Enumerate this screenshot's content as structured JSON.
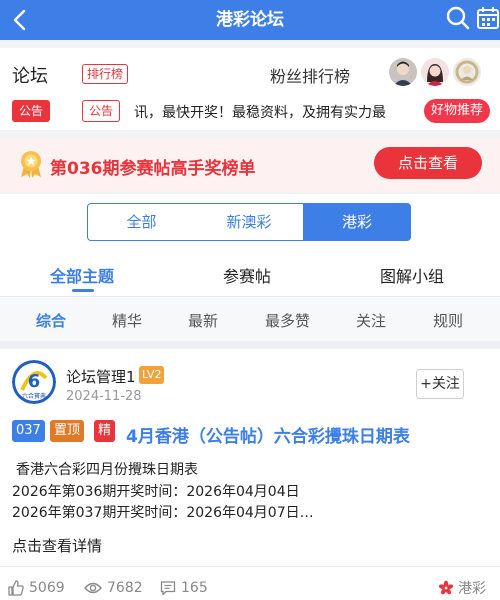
{
  "header": {
    "title": "港彩论坛"
  },
  "forum": {
    "title": "论坛",
    "rank_tag": "排行榜",
    "fans_label": "粉丝排行榜",
    "notice_tag_solid": "公告",
    "notice_tag_outline": "公告",
    "notice_text": "讯，最快开奖！最稳资料，及拥有实力最",
    "hot_button": "好物推荐"
  },
  "award": {
    "text": "第036期参赛帖高手奖榜单",
    "button": "点击查看"
  },
  "segments": [
    "全部",
    "新澳彩",
    "港彩"
  ],
  "tabs": [
    "全部主题",
    "参赛帖",
    "图解小组"
  ],
  "filters": [
    "综合",
    "精华",
    "最新",
    "最多赞",
    "关注",
    "规则"
  ],
  "post": {
    "author": "论坛管理1",
    "level": "LV2",
    "date": "2024-11-28",
    "follow": "+关注",
    "badges": [
      "037",
      "置顶",
      "精"
    ],
    "title": "4月香港（公告帖）六合彩攪珠日期表",
    "body": [
      "香港六合彩四月份攪珠日期表",
      "2026年第036期开奖时间：2026年04月04日",
      "2026年第037期开奖时间：2026年04月07日…"
    ],
    "details_link": "点击查看详情",
    "likes": "5069",
    "views": "7682",
    "comments": "165",
    "origin": "港彩",
    "avatar_caption": "六合寶典"
  },
  "colors": {
    "primary": "#3d7fe6",
    "red": "#e8343a",
    "orange": "#e07a28"
  }
}
